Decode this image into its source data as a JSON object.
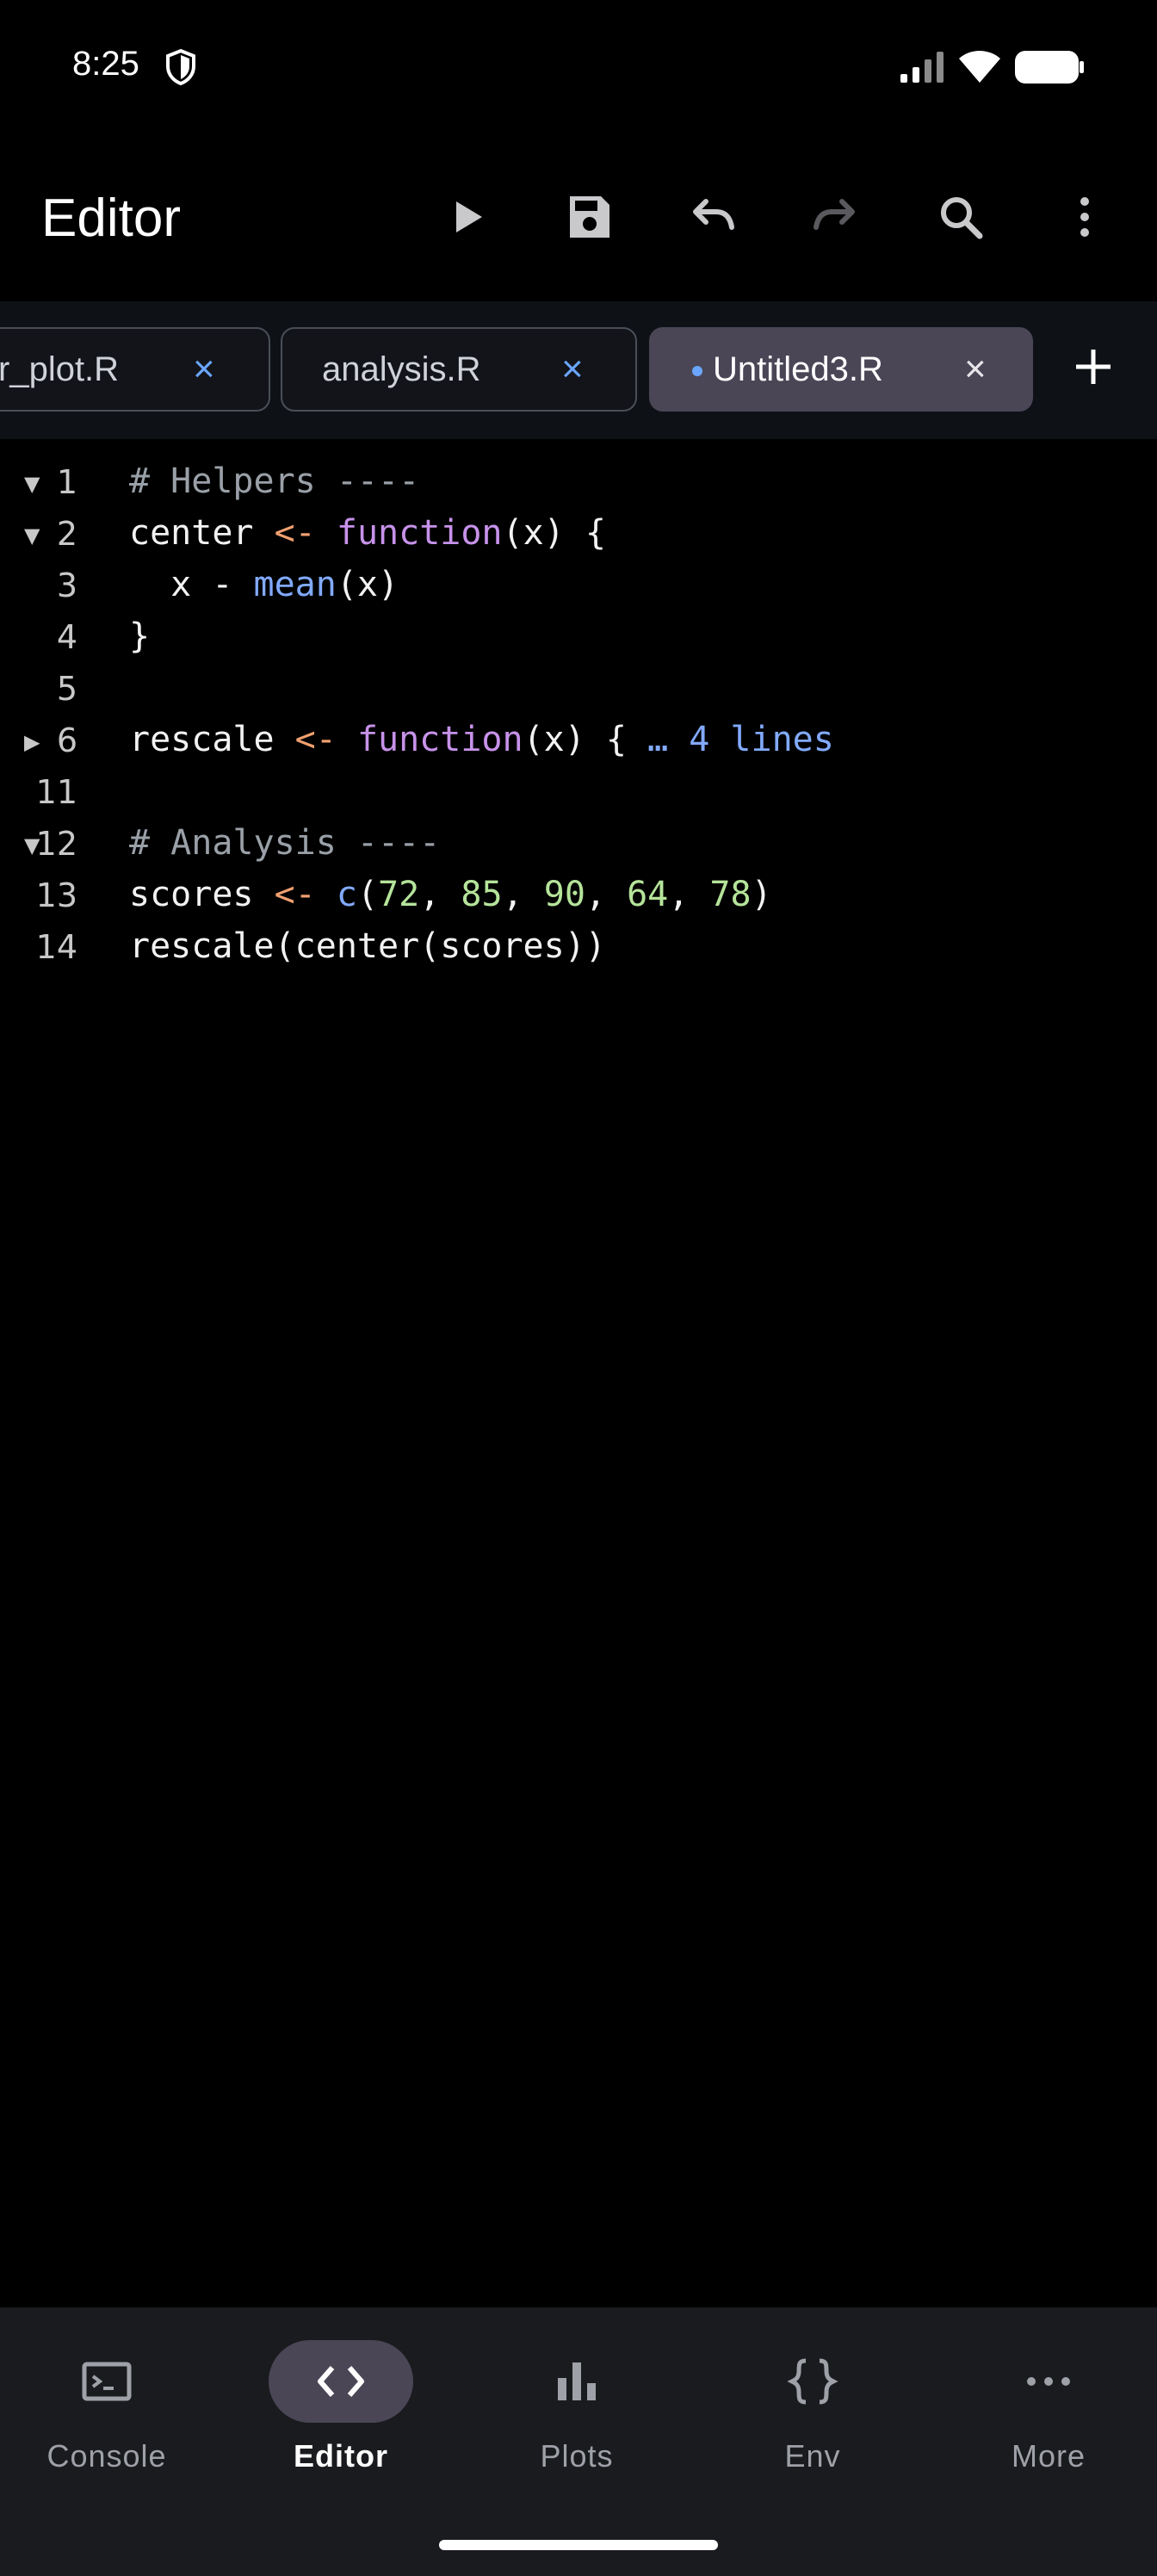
{
  "status_bar": {
    "time": "8:25"
  },
  "toolbar": {
    "title": "Editor"
  },
  "tabs": [
    {
      "label": "r_plot.R",
      "close": "×"
    },
    {
      "label": "analysis.R",
      "close": "×"
    },
    {
      "label": "Untitled3.R",
      "close": "×",
      "modified": true
    }
  ],
  "editor": {
    "lines": [
      {
        "number": "1",
        "fold": "▼"
      },
      {
        "number": "2",
        "fold": "▼"
      },
      {
        "number": "3",
        "fold": ""
      },
      {
        "number": "4",
        "fold": ""
      },
      {
        "number": "5",
        "fold": ""
      },
      {
        "number": "6",
        "fold": "▶"
      },
      {
        "number": "11",
        "fold": ""
      },
      {
        "number": "12",
        "fold": "▼"
      },
      {
        "number": "13",
        "fold": ""
      },
      {
        "number": "14",
        "fold": ""
      }
    ],
    "code": {
      "l1": "# Helpers ----",
      "l2_name": "center",
      "op": "<-",
      "kw": "function",
      "l2_rest": "(x) {",
      "l3_a": "  x - ",
      "l3_fn": "mean",
      "l3_b": "(x)",
      "l4": "}",
      "l6_name": "rescale",
      "l6_rest": "(x) { ",
      "l6_fold": "… 4 lines",
      "l12": "# Analysis ----",
      "l13_name": "scores",
      "l13_fn": "c",
      "l13_open": "(",
      "n1": "72",
      "n2": "85",
      "n3": "90",
      "n4": "64",
      "n5": "78",
      "comma": ", ",
      "l13_close": ")",
      "l14": "rescale(center(scores))"
    }
  },
  "bottom_nav": [
    {
      "label": "Console",
      "icon": "terminal-icon"
    },
    {
      "label": "Editor",
      "icon": "code-icon",
      "active": true
    },
    {
      "label": "Plots",
      "icon": "bar-chart-icon"
    },
    {
      "label": "Env",
      "icon": "braces-icon"
    },
    {
      "label": "More",
      "icon": "more-horizontal-icon"
    }
  ]
}
